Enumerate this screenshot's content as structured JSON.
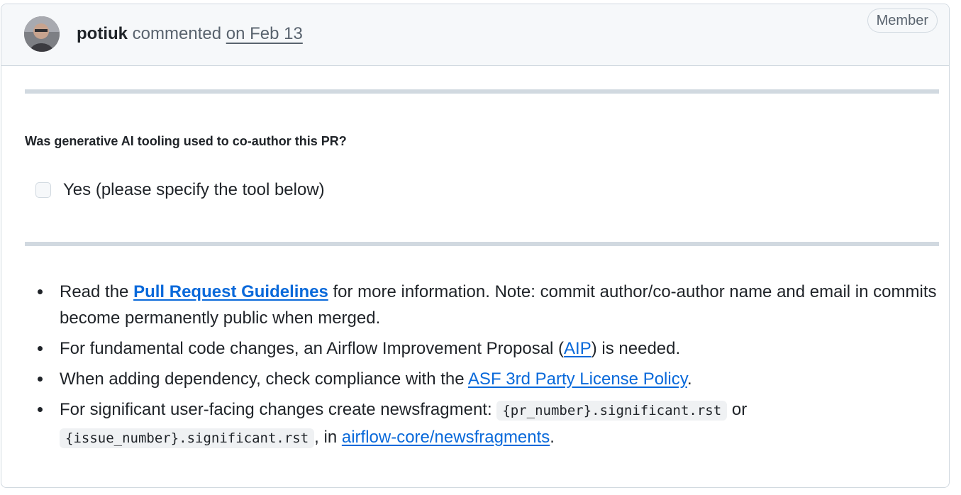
{
  "comment": {
    "author": "potiuk",
    "action": "commented",
    "date": "on Feb 13",
    "role_badge": "Member"
  },
  "question": "Was generative AI tooling used to co-author this PR?",
  "task": {
    "label": "Yes (please specify the tool below)",
    "checked": false
  },
  "bullets": {
    "b1": {
      "pre": "Read the ",
      "link": "Pull Request Guidelines",
      "post": " for more information. Note: commit author/co-author name and email in commits become permanently public when merged."
    },
    "b2": {
      "pre": "For fundamental code changes, an Airflow Improvement Proposal (",
      "link": "AIP",
      "post": ") is needed."
    },
    "b3": {
      "pre": "When adding dependency, check compliance with the ",
      "link": "ASF 3rd Party License Policy",
      "post": "."
    },
    "b4": {
      "pre": "For significant user-facing changes create newsfragment: ",
      "code1": "{pr_number}.significant.rst",
      "mid": " or ",
      "code2": "{issue_number}.significant.rst",
      "mid2": ", in ",
      "link": "airflow-core/newsfragments",
      "post": "."
    }
  },
  "colors": {
    "link": "#0969da",
    "muted": "#59636e",
    "border": "#d1d9e0",
    "header_bg": "#f6f8fa"
  }
}
